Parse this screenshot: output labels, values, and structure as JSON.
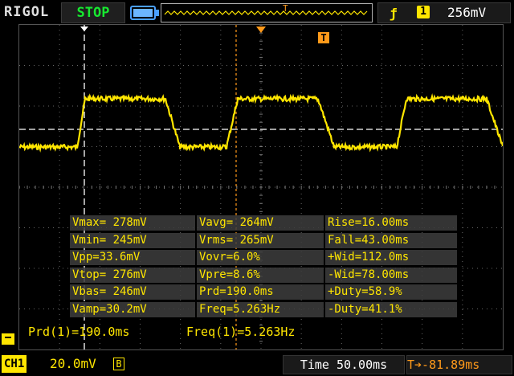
{
  "topbar": {
    "brand": "RIGOL",
    "run_state": "STOP",
    "trigger": {
      "edge_symbol": "ƒ",
      "channel": "1",
      "level": "256mV"
    },
    "memory_marker": "T"
  },
  "screen": {
    "trigger_marker": "T"
  },
  "measurements": {
    "rows": [
      [
        "Vmax= 278mV",
        "Vavg= 264mV",
        "Rise=16.00ms"
      ],
      [
        "Vmin= 245mV",
        "Vrms= 265mV",
        "Fall=43.00ms"
      ],
      [
        "Vpp=33.6mV",
        "Vovr=6.0%",
        "+Wid=112.0ms"
      ],
      [
        "Vtop= 276mV",
        "Vpre=8.6%",
        "-Wid=78.00ms"
      ],
      [
        "Vbas= 246mV",
        "Prd=190.0ms",
        "+Duty=58.9%"
      ],
      [
        "Vamp=30.2mV",
        "Freq=5.263Hz",
        "-Duty=41.1%"
      ]
    ]
  },
  "stats": {
    "prd": "Prd(1)=190.0ms",
    "freq": "Freq(1)=5.263Hz"
  },
  "footer": {
    "channel_label": "CH1",
    "volts_div": "20.0mV",
    "bw_limit": "B",
    "timebase": "Time 50.00ms",
    "trigger_offset": "T➔-81.89ms"
  },
  "colors": {
    "channel1": "#ffe600",
    "trigger": "#ff9a1a",
    "run_state": "#17e830"
  }
}
